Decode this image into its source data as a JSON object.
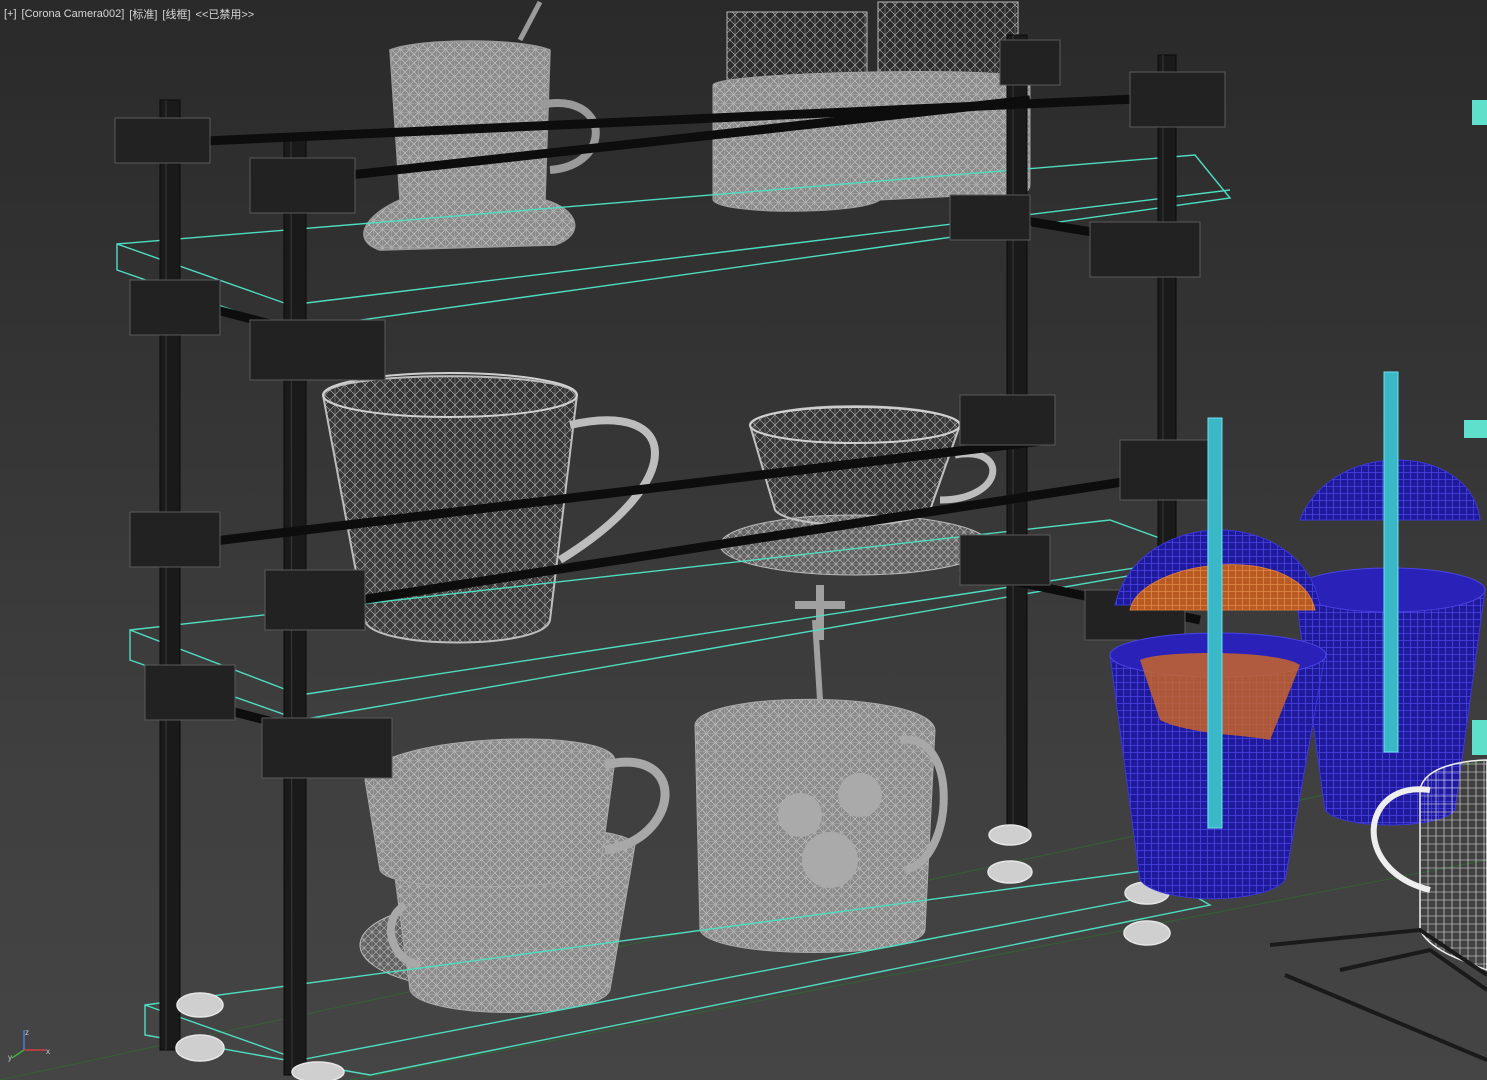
{
  "viewport": {
    "menu": {
      "plus": "[+]",
      "camera": "[Corona Camera002]",
      "shading": "[标准]",
      "display": "[线框]",
      "status": "<<已禁用>>"
    },
    "axis_icon": "axis-tripod-icon"
  },
  "colors": {
    "background_top": "#2a2a2a",
    "background_bottom": "#454545",
    "shelf_frame": "#101010",
    "shelf_board": "#58e6c8",
    "cup_wire": "#a9a9a9",
    "cup_fill": "#8c8c8c",
    "plastic_cup": "#2a22b8",
    "plastic_lid": "#c8642a",
    "straw": "#45c7d8",
    "grid_line": "#2a6a2a"
  }
}
